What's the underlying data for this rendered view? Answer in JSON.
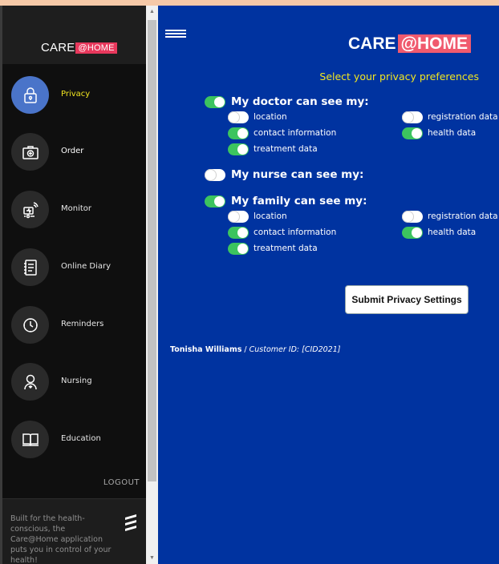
{
  "sidebar": {
    "brand": {
      "text": "CARE",
      "accent": "@HOME"
    },
    "items": [
      {
        "label": "Privacy",
        "icon": "lock-icon",
        "active": true
      },
      {
        "label": "Order",
        "icon": "medical-kit-icon",
        "active": false
      },
      {
        "label": "Monitor",
        "icon": "remote-monitor-icon",
        "active": false
      },
      {
        "label": "Online Diary",
        "icon": "diary-icon",
        "active": false
      },
      {
        "label": "Reminders",
        "icon": "clock-icon",
        "active": false
      },
      {
        "label": "Nursing",
        "icon": "nurse-icon",
        "active": false
      },
      {
        "label": "Education",
        "icon": "book-icon",
        "active": false
      }
    ],
    "logout_label": "LOGOUT",
    "footer_text": "Built for the health-conscious, the Care@Home application puts you in control of your health!",
    "footer_logo": "brand-stripes-logo"
  },
  "header": {
    "menu_icon": "hamburger-icon",
    "brand": {
      "text": "CARE",
      "accent": "@HOME"
    },
    "subtitle": "Select your privacy preferences"
  },
  "privacy": {
    "doctor": {
      "title": "My doctor can see my:",
      "enabled": true,
      "options": [
        {
          "label": "location",
          "on": false
        },
        {
          "label": "registration data",
          "on": false
        },
        {
          "label": "contact information",
          "on": true
        },
        {
          "label": "health data",
          "on": true
        },
        {
          "label": "treatment data",
          "on": true
        }
      ]
    },
    "nurse": {
      "title": "My nurse can see my:",
      "enabled": false
    },
    "family": {
      "title": "My family can see my:",
      "enabled": true,
      "options": [
        {
          "label": "location",
          "on": false
        },
        {
          "label": "registration data",
          "on": false
        },
        {
          "label": "contact information",
          "on": true
        },
        {
          "label": "health data",
          "on": true
        },
        {
          "label": "treatment data",
          "on": true
        }
      ]
    }
  },
  "submit_label": "Submit Privacy Settings",
  "user": {
    "name": "Tonisha Williams",
    "separator": " / ",
    "customer_id": "Customer ID: [CID2021]"
  },
  "colors": {
    "main_bg": "#0033a0",
    "accent_yellow": "#f2e620",
    "toggle_on": "#3cc45f",
    "home_badge": "#e8385c",
    "active_nav": "#4a74c9"
  }
}
